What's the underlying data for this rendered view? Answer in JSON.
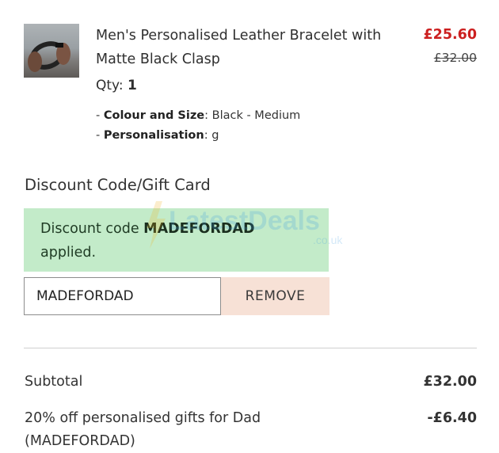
{
  "product": {
    "title": "Men's Personalised Leather Bracelet with Matte Black Clasp",
    "price_current": "£25.60",
    "price_original": "£32.00",
    "qty_label": "Qty:",
    "qty_value": "1",
    "options": [
      {
        "name": "Colour and Size",
        "value": "Black - Medium"
      },
      {
        "name": "Personalisation",
        "value": "g"
      }
    ],
    "image_icon": "bracelet-photo"
  },
  "discount": {
    "heading": "Discount Code/Gift Card",
    "message_prefix": "Discount code ",
    "message_code": "MADEFORDAD",
    "message_suffix": "applied.",
    "input_value": "MADEFORDAD",
    "remove_label": "REMOVE"
  },
  "summary": {
    "subtotal_label": "Subtotal",
    "subtotal_value": "£32.00",
    "discount_label": "20% off personalised gifts for Dad (MADEFORDAD)",
    "discount_value": "-£6.40"
  },
  "watermark": {
    "brand_text": "LatestDeals",
    "domain_text": ".co.uk"
  },
  "colors": {
    "sale_price": "#cc1f1f",
    "applied_bg": "#c3ebc9",
    "remove_bg": "#f7e1d6",
    "divider": "#cfcfcf"
  }
}
